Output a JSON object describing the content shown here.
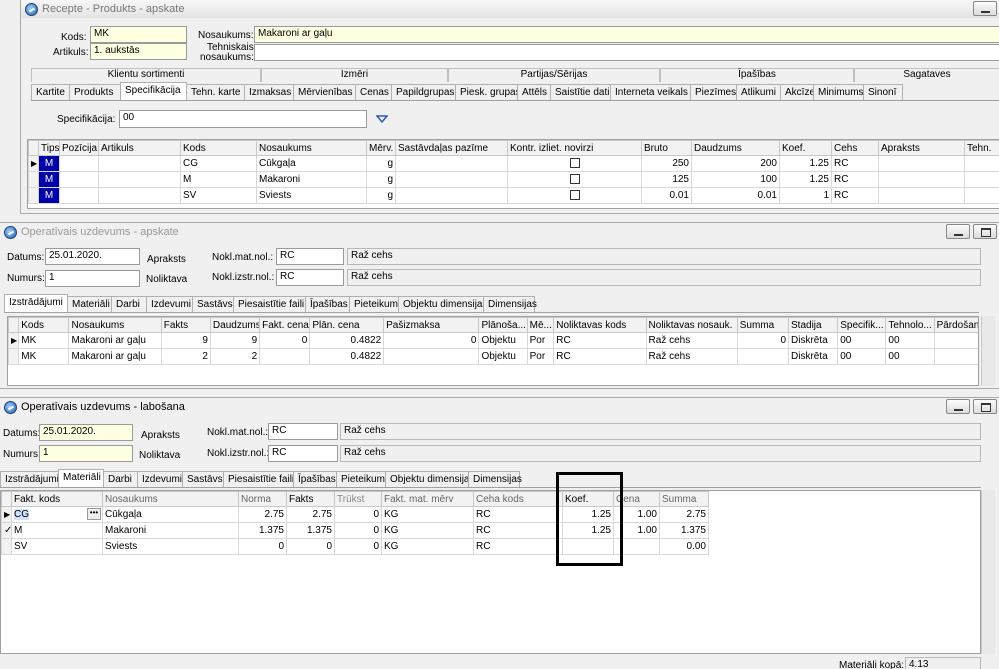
{
  "w1": {
    "title": "Recepte - Produkts - apskate",
    "kods_label": "Kods:",
    "kods_value": "MK",
    "artikuls_label": "Artikuls:",
    "artikuls_value": "1. aukstās",
    "nosaukums_label": "Nosaukums:",
    "nosaukums_value": "Makaroni ar gaļu",
    "tehn_label_1": "Tehniskais",
    "tehn_label_2": "nosaukums:",
    "tehn_value": "",
    "group_headers": [
      "Klientu sortimenti",
      "Izmēri",
      "Partijas/Sērijas",
      "Īpašības",
      "Sagataves"
    ],
    "tabs": [
      "Kartite",
      "Produkts",
      "Specifikācija",
      "Tehn. karte",
      "Izmaksas",
      "Mērvienības",
      "Cenas",
      "Papildgrupas",
      "Piesk. grupas",
      "Attēls",
      "Saistītie dati",
      "Interneta veikals",
      "Piezīmes",
      "Atlikumi",
      "Akcīze",
      "Minimums",
      "Sinonī"
    ],
    "spec_label": "Specifikācija:",
    "spec_value": "00",
    "columns": [
      "Tips",
      "Pozīcija",
      "Artikuls",
      "Kods",
      "Nosaukums",
      "Mērv.",
      "Sastāvdaļas pazīme",
      "Kontr. izliet. novirzi",
      "Bruto",
      "Daudzums",
      "Koef.",
      "Cehs",
      "Apraksts",
      "Tehn."
    ],
    "rows": [
      {
        "tips": "M",
        "poz": "",
        "art": "",
        "kods": "CG",
        "nos": "Cūkgaļa",
        "merv": "g",
        "saz": "",
        "bruto": "250",
        "daudz": "200",
        "koef": "1.25",
        "cehs": "RC"
      },
      {
        "tips": "M",
        "poz": "",
        "art": "",
        "kods": "M",
        "nos": "Makaroni",
        "merv": "g",
        "saz": "",
        "bruto": "125",
        "daudz": "100",
        "koef": "1.25",
        "cehs": "RC"
      },
      {
        "tips": "M",
        "poz": "",
        "art": "",
        "kods": "SV",
        "nos": "Sviests",
        "merv": "g",
        "saz": "",
        "bruto": "0.01",
        "daudz": "0.01",
        "koef": "1",
        "cehs": "RC"
      }
    ]
  },
  "w2": {
    "title": "Operatīvais uzdevums - apskate",
    "datums_label": "Datums:",
    "datums_value": "25.01.2020.",
    "numurs_label": "Numurs:",
    "numurs_value": "1",
    "apraksts_label": "Apraksts",
    "noliktava_label": "Noliktava",
    "nokl_mat_label": "Nokl.mat.nol.:",
    "nokl_mat_code": "RC",
    "nokl_mat_name": "Raž cehs",
    "nokl_izstr_label": "Nokl.izstr.nol.:",
    "nokl_izstr_code": "RC",
    "nokl_izstr_name": "Raž cehs",
    "tabs": [
      "Izstrādājumi",
      "Materiāli",
      "Darbi",
      "Izdevumi",
      "Sastāvs",
      "Piesaistītie faili",
      "Īpašības",
      "Pieteikumi",
      "Objektu dimensijas",
      "Dimensijas"
    ],
    "columns": [
      "Kods",
      "Nosaukums",
      "Fakts",
      "Daudzums",
      "Fakt. cena",
      "Plān. cena",
      "Pašizmaksa",
      "Plānoša...",
      "Mē...",
      "Noliktavas kods",
      "Noliktavas nosauk.",
      "Summa",
      "Stadija",
      "Specifik...",
      "Tehnolo...",
      "Pārdošanas"
    ],
    "rows": [
      {
        "kods": "MK",
        "nos": "Makaroni ar gaļu",
        "fakts": "9",
        "daudz": "9",
        "fcena": "0",
        "pcena": "0.4822",
        "pasiz": "0",
        "plan": "Objektu",
        "me": "Por",
        "nkods": "RC",
        "nnos": "Raž cehs",
        "summa": "0",
        "stad": "Diskrēta",
        "spec": "00",
        "tehn": "00",
        "pard": ""
      },
      {
        "kods": "MK",
        "nos": "Makaroni ar gaļu",
        "fakts": "2",
        "daudz": "2",
        "fcena": "",
        "pcena": "0.4822",
        "pasiz": "",
        "plan": "Objektu",
        "me": "Por",
        "nkods": "RC",
        "nnos": "Raž cehs",
        "summa": "",
        "stad": "Diskrēta",
        "spec": "00",
        "tehn": "00",
        "pard": ""
      }
    ]
  },
  "w3": {
    "title": "Operatīvais uzdevums - labošana",
    "datums_label": "Datums:",
    "datums_value": "25.01.2020.",
    "numurs_label": "Numurs:",
    "numurs_value": "1",
    "apraksts_label": "Apraksts",
    "noliktava_label": "Noliktava",
    "nokl_mat_label": "Nokl.mat.nol.:",
    "nokl_mat_code": "RC",
    "nokl_mat_name": "Raž cehs",
    "nokl_izstr_label": "Nokl.izstr.nol.:",
    "nokl_izstr_code": "RC",
    "nokl_izstr_name": "Raž cehs",
    "tabs": [
      "Izstrādājumi",
      "Materiāli",
      "Darbi",
      "Izdevumi",
      "Sastāvs",
      "Piesaistītie faili",
      "Īpašības",
      "Pieteikumi",
      "Objektu dimensijas",
      "Dimensijas"
    ],
    "columns": [
      "Fakt. kods",
      "Nosaukums",
      "Norma",
      "Fakts",
      "Trūkst",
      "Fakt. mat. mērv",
      "Ceha kods",
      "Koef.",
      "Cena",
      "Summa"
    ],
    "rows": [
      {
        "kods": "CG",
        "nos": "Cūkgaļa",
        "norma": "2.75",
        "fakts": "2.75",
        "trukst": "0",
        "merv": "KG",
        "ceha": "RC",
        "koef": "1.25",
        "cena": "1.00",
        "summa": "2.75"
      },
      {
        "kods": "M",
        "nos": "Makaroni",
        "norma": "1.375",
        "fakts": "1.375",
        "trukst": "0",
        "merv": "KG",
        "ceha": "RC",
        "koef": "1.25",
        "cena": "1.00",
        "summa": "1.375"
      },
      {
        "kods": "SV",
        "nos": "Sviests",
        "norma": "0",
        "fakts": "0",
        "trukst": "0",
        "merv": "KG",
        "ceha": "RC",
        "koef": "",
        "cena": "",
        "summa": "0.00"
      }
    ],
    "total_label": "Materiāli kopā:",
    "total_value": "4.13"
  }
}
